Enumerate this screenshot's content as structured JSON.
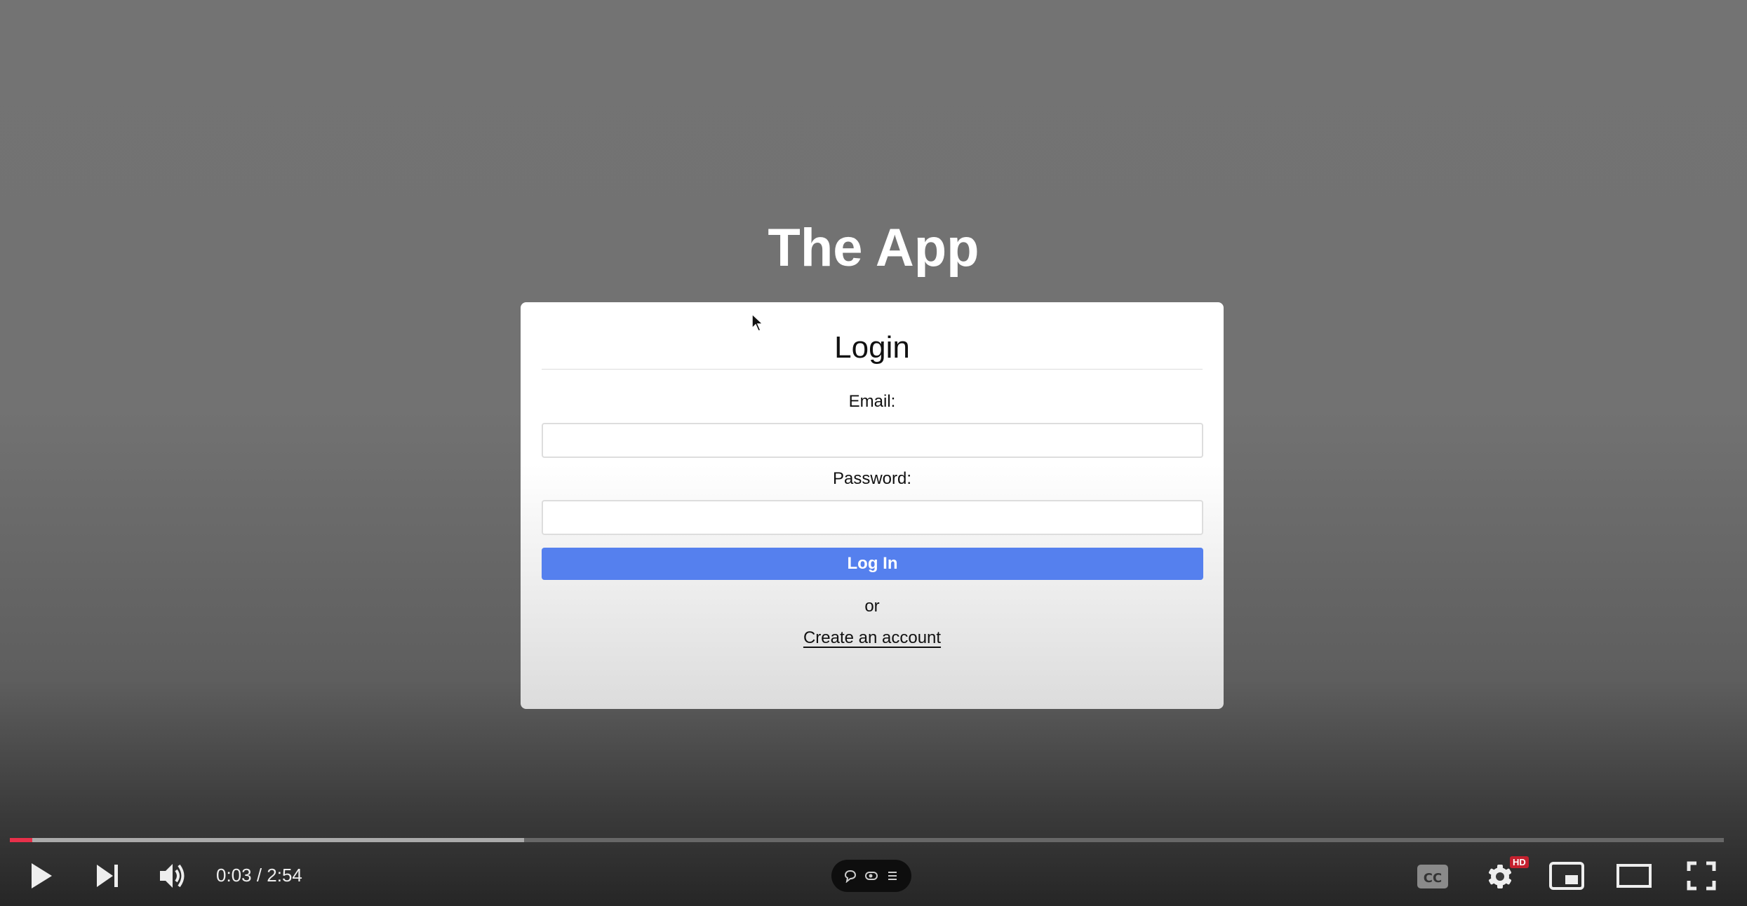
{
  "app": {
    "title": "The App"
  },
  "login": {
    "heading": "Login",
    "email_label": "Email:",
    "email_value": "",
    "password_label": "Password:",
    "password_value": "",
    "submit_label": "Log In",
    "or_text": "or",
    "create_account_link": "Create an account"
  },
  "player": {
    "current_time": "0:03",
    "separator": " / ",
    "duration": "2:54",
    "played_fraction": 0.013,
    "buffered_fraction": 0.3,
    "hd_badge": "HD",
    "progress_color": "#e8304a",
    "button_color": "#5580ee",
    "icons": [
      "play-icon",
      "next-icon",
      "volume-icon",
      "comment-icon",
      "toggle-icon",
      "list-icon",
      "captions-icon",
      "settings-icon",
      "miniplayer-icon",
      "theater-icon",
      "fullscreen-icon"
    ]
  }
}
